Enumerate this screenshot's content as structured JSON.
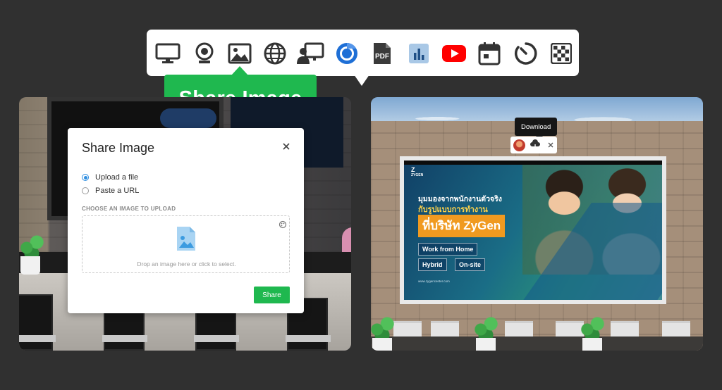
{
  "toolbar": {
    "items": [
      {
        "name": "monitor-icon"
      },
      {
        "name": "webcam-icon"
      },
      {
        "name": "image-icon"
      },
      {
        "name": "globe-icon"
      },
      {
        "name": "screen-presenter-icon"
      },
      {
        "name": "chrome-icon"
      },
      {
        "name": "pdf-icon",
        "label": "PDF"
      },
      {
        "name": "bar-chart-icon"
      },
      {
        "name": "youtube-icon"
      },
      {
        "name": "calendar-icon"
      },
      {
        "name": "timer-icon"
      },
      {
        "name": "checkerboard-icon"
      }
    ],
    "callout": "Share Image",
    "colors": {
      "callout": "#1fb84f",
      "youtube": "#ff0000"
    }
  },
  "dialog": {
    "title": "Share Image",
    "options": [
      "Upload a file",
      "Paste a URL"
    ],
    "selected_option": "Upload a file",
    "section_label": "CHOOSE AN IMAGE TO UPLOAD",
    "drop_text": "Drop an image here or click to select.",
    "share_label": "Share"
  },
  "screen": {
    "tooltip": "Download",
    "poster": {
      "logo": "Z",
      "logo_sub": "ZYGEN",
      "line1": "มุมมองจากพนักงานตัวจริง",
      "line2": "กับรูปแบบการทำงาน",
      "highlight": "ที่บริษัท ZyGen",
      "tags": [
        "Work from Home",
        "Hybrid",
        "On-site"
      ],
      "footer": "www.zygencenter.com"
    }
  }
}
